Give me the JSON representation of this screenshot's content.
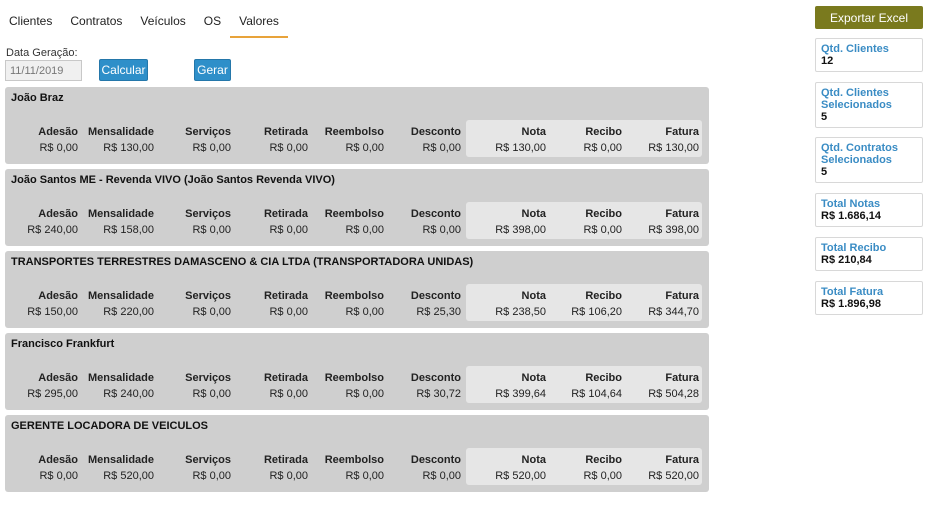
{
  "tabs": [
    "Clientes",
    "Contratos",
    "Veículos",
    "OS",
    "Valores"
  ],
  "active_tab": "Valores",
  "accent_color": "#e8a33a",
  "date_label": "Data Geração:",
  "date_value": "11/11/2019",
  "calcular_label": "Calcular",
  "gerar_label": "Gerar",
  "export_label": "Exportar Excel",
  "columns": [
    "Adesão",
    "Mensalidade",
    "Serviços",
    "Retirada",
    "Reembolso",
    "Desconto",
    "Nota",
    "Recibo",
    "Fatura"
  ],
  "clients": [
    {
      "name": "João Braz",
      "values": [
        "R$ 0,00",
        "R$ 130,00",
        "R$ 0,00",
        "R$ 0,00",
        "R$ 0,00",
        "R$ 0,00",
        "R$ 130,00",
        "R$ 0,00",
        "R$ 130,00"
      ]
    },
    {
      "name": "João Santos ME - Revenda VIVO (João Santos Revenda VIVO)",
      "values": [
        "R$ 240,00",
        "R$ 158,00",
        "R$ 0,00",
        "R$ 0,00",
        "R$ 0,00",
        "R$ 0,00",
        "R$ 398,00",
        "R$ 0,00",
        "R$ 398,00"
      ]
    },
    {
      "name": "TRANSPORTES TERRESTRES DAMASCENO & CIA LTDA (TRANSPORTADORA UNIDAS)",
      "values": [
        "R$ 150,00",
        "R$ 220,00",
        "R$ 0,00",
        "R$ 0,00",
        "R$ 0,00",
        "R$ 25,30",
        "R$ 238,50",
        "R$ 106,20",
        "R$ 344,70"
      ]
    },
    {
      "name": "Francisco Frankfurt",
      "values": [
        "R$ 295,00",
        "R$ 240,00",
        "R$ 0,00",
        "R$ 0,00",
        "R$ 0,00",
        "R$ 30,72",
        "R$ 399,64",
        "R$ 104,64",
        "R$ 504,28"
      ]
    },
    {
      "name": "GERENTE LOCADORA DE VEICULOS",
      "values": [
        "R$ 0,00",
        "R$ 520,00",
        "R$ 0,00",
        "R$ 0,00",
        "R$ 0,00",
        "R$ 0,00",
        "R$ 520,00",
        "R$ 0,00",
        "R$ 520,00"
      ]
    }
  ],
  "stats": [
    {
      "title": "Qtd. Clientes",
      "value": "12"
    },
    {
      "title": "Qtd. Clientes Selecionados",
      "value": "5"
    },
    {
      "title": "Qtd. Contratos Selecionados",
      "value": "5"
    },
    {
      "title": "Total Notas",
      "value": "R$ 1.686,14"
    },
    {
      "title": "Total Recibo",
      "value": "R$ 210,84"
    },
    {
      "title": "Total Fatura",
      "value": "R$ 1.896,98"
    }
  ]
}
